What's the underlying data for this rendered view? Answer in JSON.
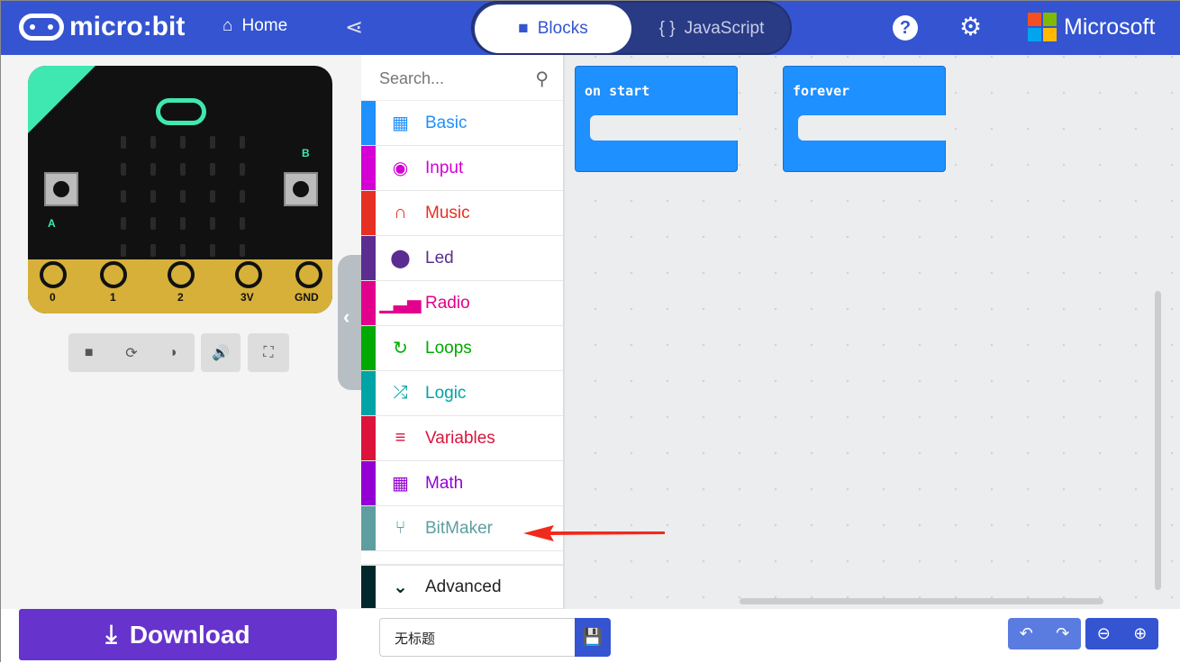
{
  "header": {
    "logo": "micro:bit",
    "home": "Home",
    "tabs": [
      {
        "label": "Blocks",
        "active": true
      },
      {
        "label": "JavaScript",
        "active": false
      }
    ],
    "brand": "Microsoft",
    "color": "#3454D1"
  },
  "simulator": {
    "pins": [
      "0",
      "1",
      "2",
      "3V",
      "GND"
    ],
    "buttons": [
      "A",
      "B"
    ]
  },
  "toolbox": {
    "search_placeholder": "Search...",
    "categories": [
      {
        "label": "Basic",
        "color": "#1E90FF",
        "icon": "grid-icon"
      },
      {
        "label": "Input",
        "color": "#D400D4",
        "icon": "target-icon"
      },
      {
        "label": "Music",
        "color": "#E63022",
        "icon": "headphones-icon"
      },
      {
        "label": "Led",
        "color": "#5C2D91",
        "icon": "toggle-icon"
      },
      {
        "label": "Radio",
        "color": "#E3008C",
        "icon": "signal-icon"
      },
      {
        "label": "Loops",
        "color": "#00AA00",
        "icon": "refresh-icon"
      },
      {
        "label": "Logic",
        "color": "#00A4A6",
        "icon": "shuffle-icon"
      },
      {
        "label": "Variables",
        "color": "#DC143C",
        "icon": "list-icon"
      },
      {
        "label": "Math",
        "color": "#9400D3",
        "icon": "calculator-icon"
      },
      {
        "label": "BitMaker",
        "color": "#5F9EA0",
        "icon": "branch-icon"
      }
    ],
    "advanced": {
      "label": "Advanced",
      "color": "#00272B"
    }
  },
  "workspace": {
    "blocks": [
      "on start",
      "forever"
    ]
  },
  "bottom": {
    "download": "Download",
    "project_name": "无标题"
  }
}
